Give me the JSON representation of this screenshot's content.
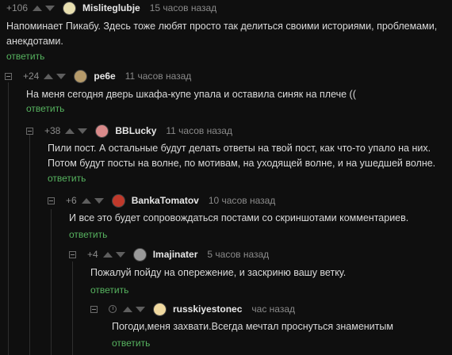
{
  "comments": [
    {
      "rating": "+106",
      "author": "Misliteglubje",
      "time": "15 часов назад",
      "text_lines": [
        "Напоминает Пикабу. Здесь тоже любят просто так делиться своими историями, проблемами,",
        "анекдотами."
      ],
      "reply_label": "ответить",
      "avatar_color": "#e8dfb0"
    },
    {
      "rating": "+24",
      "author": "pe6e",
      "time": "11 часов назад",
      "text_lines": [
        "На меня сегодня дверь шкафа-купе упала и оставила синяк на плече (("
      ],
      "reply_label": "ответить",
      "avatar_color": "#b59a6a"
    },
    {
      "rating": "+38",
      "author": "BBLucky",
      "time": "11 часов назад",
      "text_lines": [
        "Пили пост. А остальные будут делать ответы на твой пост, как что-то упало на них.",
        "Потом будут посты на волне, по мотивам, на уходящей волне, и на ушедшей волне."
      ],
      "reply_label": "ответить",
      "avatar_color": "#d98a8a"
    },
    {
      "rating": "+6",
      "author": "BankaTomatov",
      "time": "10 часов назад",
      "text_lines": [
        "И все это будет сопровождаться постами со скриншотами комментариев."
      ],
      "reply_label": "ответить",
      "avatar_color": "#c0392b"
    },
    {
      "rating": "+4",
      "author": "Imajinater",
      "time": "5 часов назад",
      "text_lines": [
        "Пожалуй пойду на опережение, и заскриню вашу ветку."
      ],
      "reply_label": "ответить",
      "avatar_color": "#9a9a9a"
    },
    {
      "rating": "",
      "author": "russkiyestonec",
      "time": "час назад",
      "text_lines": [
        "Погоди,меня захвати.Всегда мечтал проснуться знаменитым"
      ],
      "reply_label": "ответить",
      "avatar_color": "#f0d9a0"
    }
  ]
}
